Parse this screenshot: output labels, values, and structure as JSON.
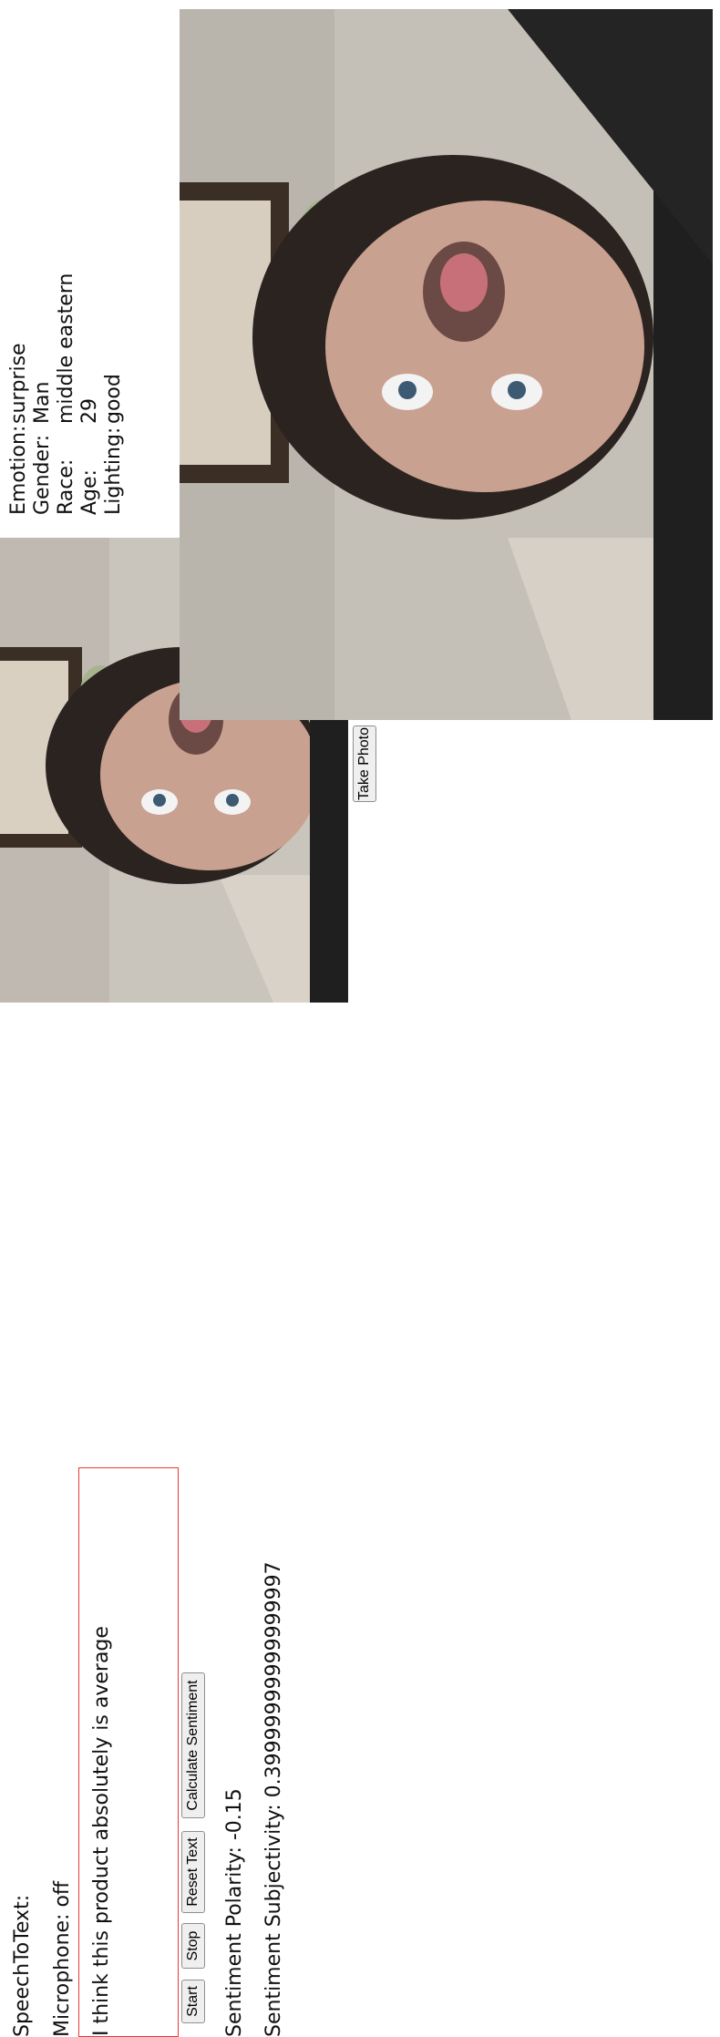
{
  "speech": {
    "title": "SpeechToText:",
    "microphone_status": "Microphone: off",
    "transcript": "I think this product absolutely is average",
    "buttons": {
      "start": "Start",
      "stop": "Stop",
      "reset": "Reset Text",
      "calculate": "Calculate Sentiment"
    },
    "polarity": "Sentiment Polarity: -0.15",
    "subjectivity": "Sentiment Subjectivity: 0.39999999999999997"
  },
  "camera": {
    "take_photo_label": "Take Photo"
  },
  "analysis": {
    "rows": [
      {
        "key": "Emotion:",
        "value": "surprise"
      },
      {
        "key": "Gender:",
        "value": "Man"
      },
      {
        "key": "Race:",
        "value": "middle eastern"
      },
      {
        "key": "Age:",
        "value": "29"
      },
      {
        "key": "Lighting:",
        "value": "good"
      }
    ]
  },
  "colors": {
    "textbox_border": "#e53935",
    "wall": "#bdb8b0",
    "shirt": "#2a2a2a"
  }
}
